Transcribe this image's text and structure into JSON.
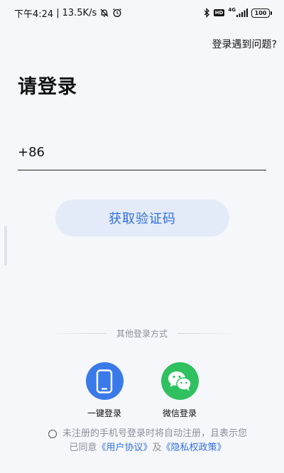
{
  "status_bar": {
    "time": "下午4:24",
    "separator": "|",
    "speed": "13.5K/s",
    "network": "4G",
    "battery": "100",
    "hd": "HD",
    "icons": [
      "mute-bell-icon",
      "alarm-icon",
      "bluetooth-icon",
      "hd-badge",
      "signal-icon",
      "battery-icon"
    ]
  },
  "header": {
    "help_link": "登录遇到问题?"
  },
  "page": {
    "title": "请登录"
  },
  "phone": {
    "country_code": "+86",
    "value": "",
    "placeholder": ""
  },
  "actions": {
    "get_code_label": "获取验证码"
  },
  "other_login": {
    "label": "其他登录方式",
    "methods": [
      {
        "label": "一键登录",
        "icon": "phone-icon",
        "color": "#3a7ae8"
      },
      {
        "label": "微信登录",
        "icon": "wechat-icon",
        "color": "#2fc160"
      }
    ]
  },
  "agreement": {
    "line1": "未注册的手机号登录时将自动注册，且表示您",
    "prefix": "已同意",
    "user_agreement": "《用户协议》",
    "conj": "及",
    "privacy_policy": "《隐私权政策》"
  },
  "colors": {
    "accent": "#2f6fdf",
    "button_bg": "#e3ebf8",
    "background": "#f6f7fb"
  }
}
